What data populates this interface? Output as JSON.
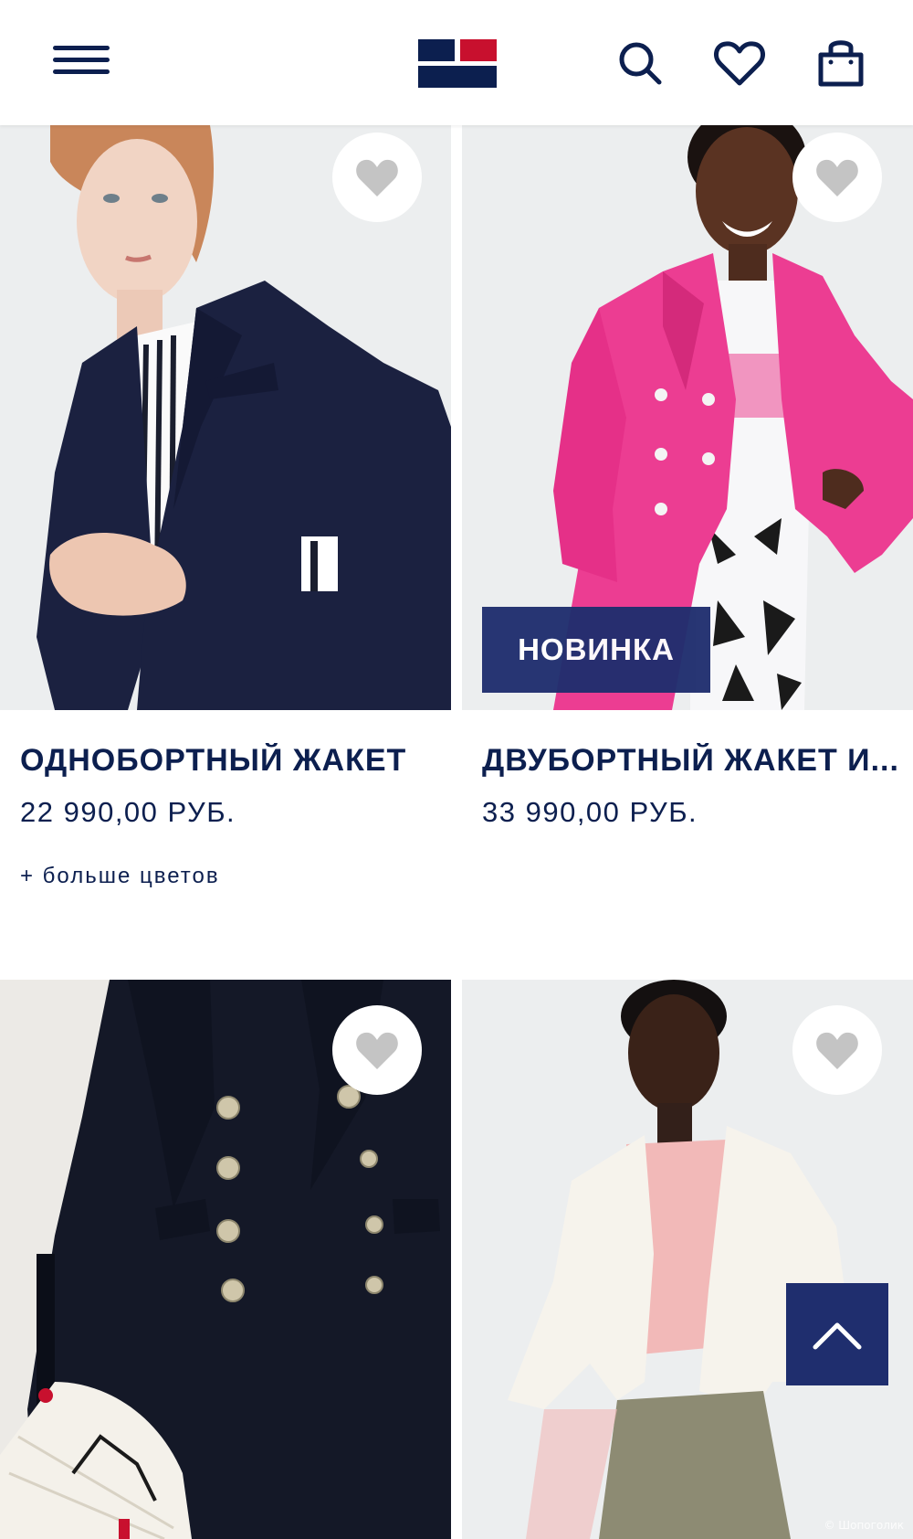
{
  "header": {
    "menu_icon": "hamburger-menu-icon",
    "logo": "tommy-hilfiger-flag-logo",
    "search_icon": "search-icon",
    "wishlist_icon": "heart-outline-icon",
    "bag_icon": "shopping-bag-icon",
    "colors": {
      "navy": "#0c1f4f",
      "red": "#c8102e"
    }
  },
  "products": [
    {
      "title": "ОДНОБОРТНЫЙ ЖАКЕТ",
      "price": "22 990,00 РУБ.",
      "more_colors": "+ больше цветов",
      "image": "woman-in-navy-single-breasted-blazer"
    },
    {
      "title": "ДВУБОРТНЫЙ ЖАКЕТ И...",
      "price": "33 990,00 РУБ.",
      "badge": "НОВИНКА",
      "image": "woman-in-pink-double-breasted-blazer"
    },
    {
      "image": "navy-double-breasted-blazer-with-gold-buttons"
    },
    {
      "image": "woman-in-white-blazer"
    }
  ],
  "scroll_top_icon": "chevron-up-icon",
  "watermark": "© Шопоголик"
}
